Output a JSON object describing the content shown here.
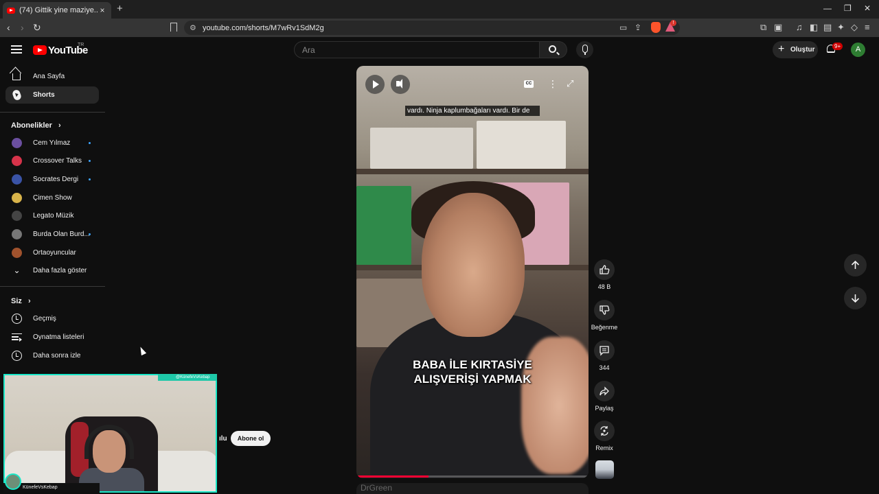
{
  "browser": {
    "tab_title": "(74) Gittik yine maziye... - YouTube",
    "url": "youtube.com/shorts/M7wRv1SdM2g",
    "new_tab": "+",
    "close_tab": "×",
    "minimize": "—",
    "restore": "❐",
    "close_window": "✕"
  },
  "header": {
    "logo": "YouTube",
    "country": "TR",
    "search_placeholder": "Ara",
    "create_label": "Oluştur",
    "notifications_badge": "9+",
    "avatar_letter": "A"
  },
  "sidebar": {
    "main": [
      {
        "label": "Ana Sayfa",
        "icon": "home-icon"
      },
      {
        "label": "Shorts",
        "icon": "shorts-icon",
        "active": true
      }
    ],
    "subscriptions_heading": "Abonelikler",
    "subscriptions": [
      {
        "label": "Cem Yılmaz",
        "color": "#6b4fa0",
        "new": true
      },
      {
        "label": "Crossover Talks",
        "color": "#d6334a",
        "new": true
      },
      {
        "label": "Socrates Dergi",
        "color": "#3a53a6",
        "new": true
      },
      {
        "label": "Çimen Show",
        "color": "#d8b34a",
        "new": false
      },
      {
        "label": "Legato Müzik",
        "color": "#444444",
        "new": false
      },
      {
        "label": "Burda Olan Burd...",
        "color": "#777777",
        "new": true
      },
      {
        "label": "Ortaoyuncular",
        "color": "#a0522d",
        "new": false
      }
    ],
    "show_more": "Daha fazla göster",
    "you_heading": "Siz",
    "you_items": [
      {
        "label": "Geçmiş",
        "icon": "history-icon"
      },
      {
        "label": "Oynatma listeleri",
        "icon": "playlist-icon"
      },
      {
        "label": "Daha sonra izle",
        "icon": "watch-later-icon"
      }
    ]
  },
  "video": {
    "caption": "vardı. Ninja kaplumbağaları vardı. Bir de",
    "overlay_line1": "BABA İLE KIRTASİYE",
    "overlay_line2": "ALIŞVERİŞİ YAPMAK",
    "cc": "CC",
    "progress_fraction": 0.31,
    "next_preview": "DrGreen"
  },
  "actions": {
    "likes": "48 B",
    "dislike": "Beğenme",
    "comments": "344",
    "share": "Paylaş",
    "remix": "Remix"
  },
  "webcam": {
    "name": "KünefeVsKebap",
    "handle": "@KünefeVsKebap"
  },
  "channel": {
    "name_fragment": "ılu",
    "subscribe": "Abone ol"
  }
}
